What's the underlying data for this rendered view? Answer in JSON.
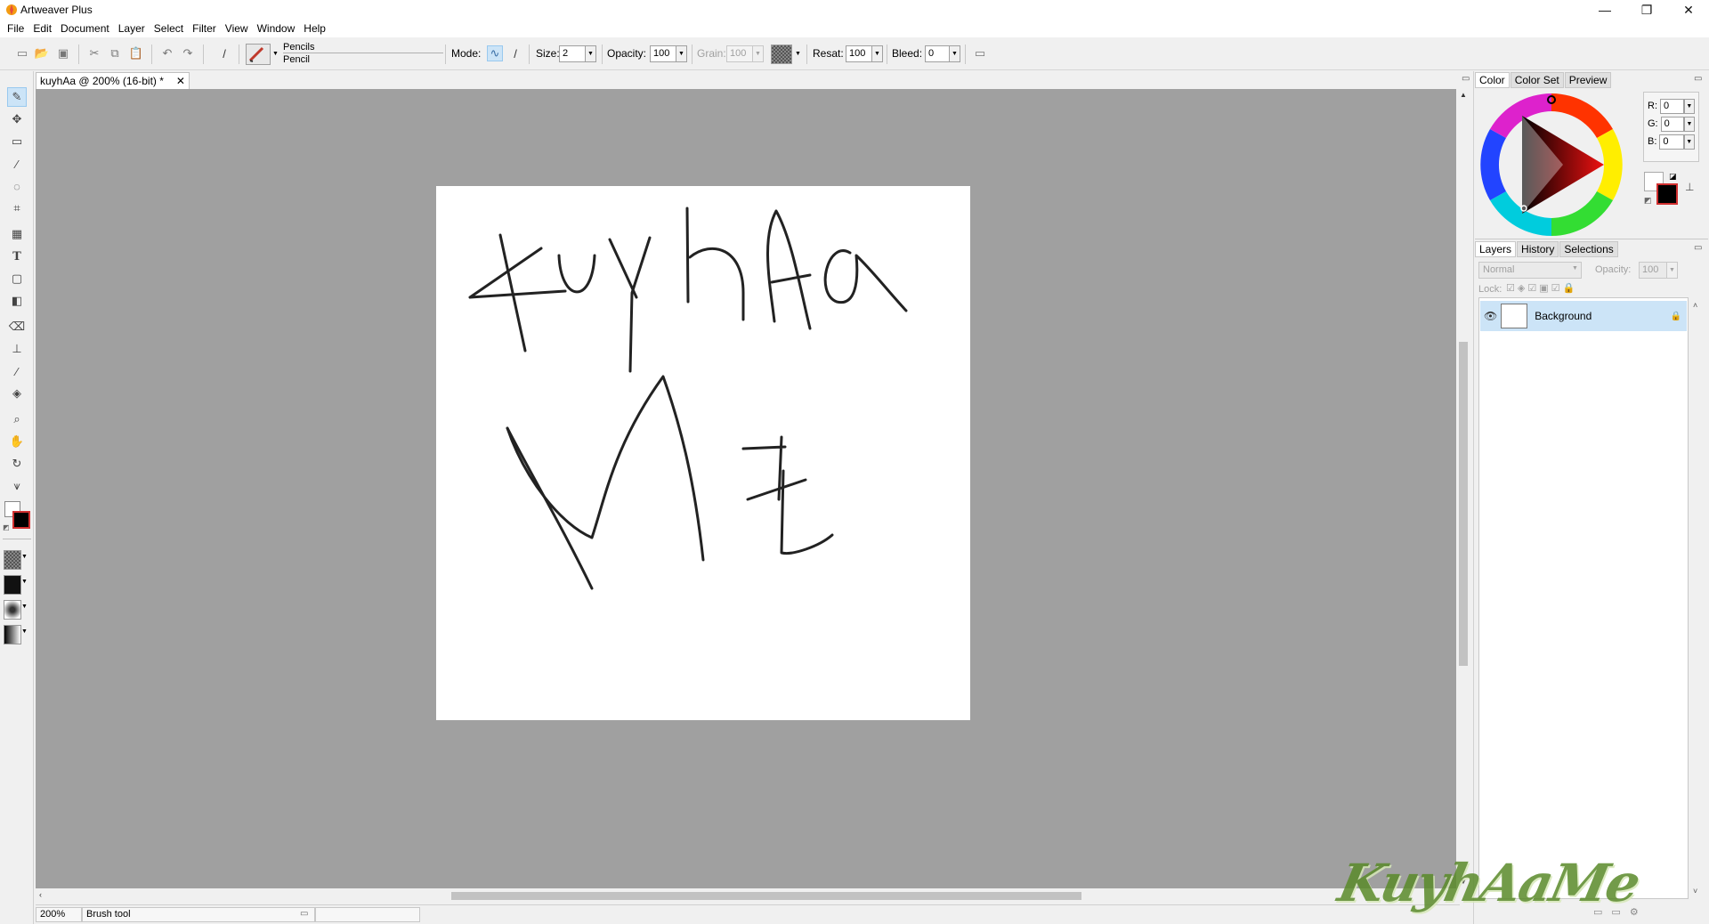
{
  "window": {
    "title": "Artweaver Plus"
  },
  "menu": [
    "File",
    "Edit",
    "Document",
    "Layer",
    "Select",
    "Filter",
    "View",
    "Window",
    "Help"
  ],
  "toolbar": {
    "brush_category": "Pencils",
    "brush_name": "Pencil",
    "mode_label": "Mode:",
    "size_label": "Size:",
    "size_value": "2",
    "opacity_label": "Opacity:",
    "opacity_value": "100",
    "grain_label": "Grain:",
    "grain_value": "100",
    "resat_label": "Resat:",
    "resat_value": "100",
    "bleed_label": "Bleed:",
    "bleed_value": "0"
  },
  "document": {
    "tab_title": "kuyhAa @ 200% (16-bit) *",
    "close_glyph": "✕",
    "canvas_text_line1": "kuyhAa",
    "canvas_text_line2": "Me"
  },
  "status": {
    "zoom": "200%",
    "tool": "Brush tool"
  },
  "color_panel": {
    "tabs": [
      "Color",
      "Color Set",
      "Preview"
    ],
    "r_label": "R:",
    "r_value": "0",
    "g_label": "G:",
    "g_value": "0",
    "b_label": "B:",
    "b_value": "0",
    "foreground": "#000000",
    "background": "#ffffff"
  },
  "layers_panel": {
    "tabs": [
      "Layers",
      "History",
      "Selections"
    ],
    "blend_mode": "Normal",
    "opacity_label": "Opacity:",
    "opacity_value": "100",
    "lock_label": "Lock:",
    "layers": [
      {
        "name": "Background",
        "visible": true,
        "locked": true
      }
    ]
  },
  "watermark": "KuyhAaMe",
  "colors": {
    "canvas_bg": "#a0a0a0",
    "selection": "#cce4f7",
    "accent": "#99c9ef"
  }
}
